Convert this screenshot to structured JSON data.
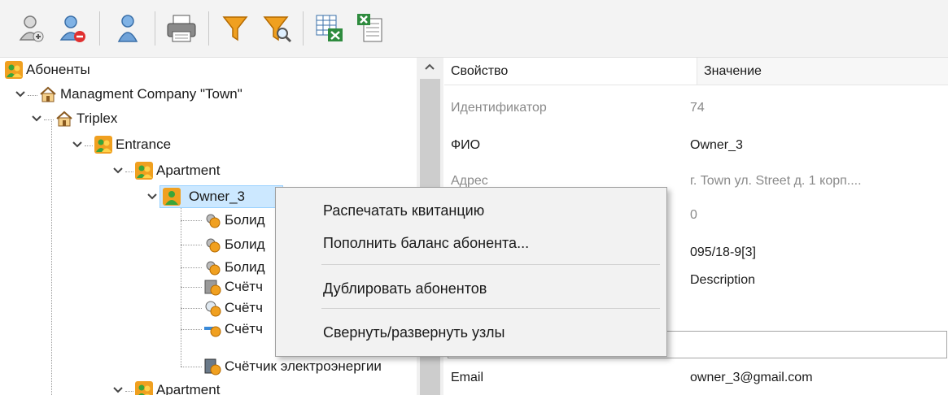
{
  "toolbar": {
    "buttons": [
      {
        "icon": "add-user-icon"
      },
      {
        "icon": "remove-user-icon"
      },
      {
        "icon": "user-icon"
      },
      {
        "icon": "printer-icon"
      },
      {
        "icon": "filter-icon"
      },
      {
        "icon": "filter-search-icon"
      },
      {
        "icon": "export-excel-icon"
      },
      {
        "icon": "import-excel-icon"
      }
    ]
  },
  "tree": {
    "root": "Абоненты",
    "company": "Managment Company \"Town\"",
    "house": "Triplex",
    "entrance": "Entrance",
    "apartment1": "Apartment",
    "owner": "Owner_3",
    "children": [
      "Болид",
      "Болид",
      "Болид",
      "Счётч",
      "Счётч",
      "Счётч",
      "Счётчик электроэнергии"
    ],
    "apartment2": "Apartment"
  },
  "props": {
    "header_key": "Свойство",
    "header_value": "Значение",
    "rows": [
      {
        "k": "Идентификатор",
        "v": "74"
      },
      {
        "k": "ФИО",
        "v": "Owner_3"
      },
      {
        "k": "Адрес",
        "v": "г. Town ул. Street д. 1 корп...."
      },
      {
        "k": "",
        "v": "0"
      },
      {
        "k": "",
        "v": "095/18-9[3]"
      },
      {
        "k": "",
        "v": "Description"
      },
      {
        "k": "Email",
        "v": "owner_3@gmail.com"
      }
    ]
  },
  "context_menu": {
    "items": [
      "Распечатать квитанцию",
      "Пополнить баланс абонента...",
      "Дублировать абонентов",
      "Свернуть/развернуть узлы"
    ]
  },
  "colors": {
    "selection": "#cce8ff",
    "menu_bg": "#f2f2f2",
    "accent_orange": "#f0a020",
    "green": "#3aa53a"
  }
}
